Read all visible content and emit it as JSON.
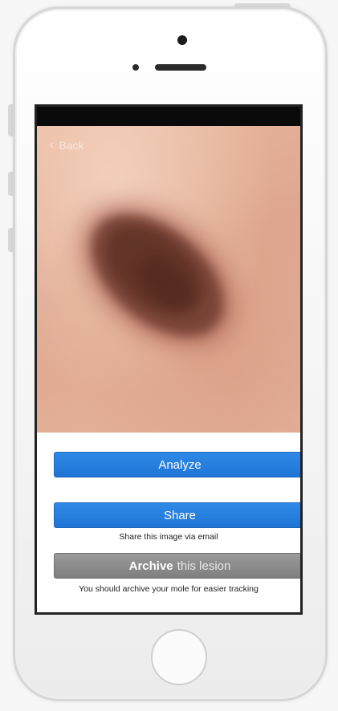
{
  "nav": {
    "back_label": "Back",
    "back_icon": "chevron-left-icon"
  },
  "actions": {
    "analyze_label": "Analyze",
    "share_label": "Share",
    "share_caption": "Share this image via email",
    "archive_label_bold": "Archive",
    "archive_label_rest": "this lesion",
    "archive_caption": "You should archive your mole for easier tracking"
  },
  "colors": {
    "primary_button": "#1f74d6",
    "secondary_button": "#8a8a8a",
    "skin_tone": "#e3ad95",
    "mole_tone": "#5a2e24"
  }
}
